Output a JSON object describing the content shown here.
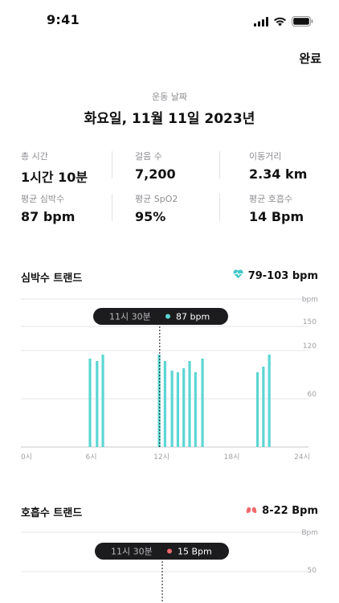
{
  "status": {
    "time": "9:41"
  },
  "toolbar": {
    "done_label": "완료"
  },
  "workout": {
    "date_caption": "운동 날짜",
    "date_title": "화요일, 11월 11일 2023년"
  },
  "stats": [
    {
      "label": "총 시간",
      "value": "1시간 10분"
    },
    {
      "label": "걸음 수",
      "value": "7,200"
    },
    {
      "label": "이동거리",
      "value": "2.34 km"
    },
    {
      "label": "평균 심박수",
      "value": "87 bpm"
    },
    {
      "label": "평균 SpO2",
      "value": "95%"
    },
    {
      "label": "평균 호흡수",
      "value": "14 Bpm"
    }
  ],
  "heart_section": {
    "title": "심박수 트랜드",
    "range": "79-103 bpm",
    "icon": "heart-icon",
    "icon_color": "#3fc7c9"
  },
  "breath_section": {
    "title": "호흡수 트랜드",
    "range": "8-22 Bpm",
    "icon": "lungs-icon",
    "icon_color": "#f0696a"
  },
  "chart_data": [
    {
      "type": "bar",
      "title": "심박수 트랜드",
      "ylabel": "bpm",
      "ylim": [
        0,
        180
      ],
      "yticks": [
        "150",
        "120",
        "60"
      ],
      "ytick_values": [
        150,
        120,
        60
      ],
      "xlim": [
        0,
        24
      ],
      "xticks": [
        "0시",
        "6시",
        "12시",
        "18시",
        "24시"
      ],
      "xtick_values": [
        0,
        6,
        12,
        18,
        24
      ],
      "bar_color": "#5cd6d3",
      "x": [
        5.9,
        6.5,
        7.0,
        11.8,
        12.3,
        12.9,
        13.4,
        13.9,
        14.4,
        14.9,
        15.5,
        20.2,
        20.7,
        21.2
      ],
      "values": [
        110,
        107,
        115,
        115,
        107,
        95,
        93,
        98,
        107,
        93,
        110,
        93,
        100,
        115
      ],
      "tooltip": {
        "time": "11시 30분",
        "value": "87 bpm",
        "dot_color": "#5cd6d3",
        "x": 11.85
      },
      "grid": true
    },
    {
      "type": "bar",
      "title": "호흡수 트랜드",
      "ylabel": "Bpm",
      "yticks": [
        "50"
      ],
      "ytick_values": [
        50
      ],
      "tooltip": {
        "time": "11시 30분",
        "value": "15 Bpm",
        "dot_color": "#f0696a"
      },
      "grid": true
    }
  ]
}
